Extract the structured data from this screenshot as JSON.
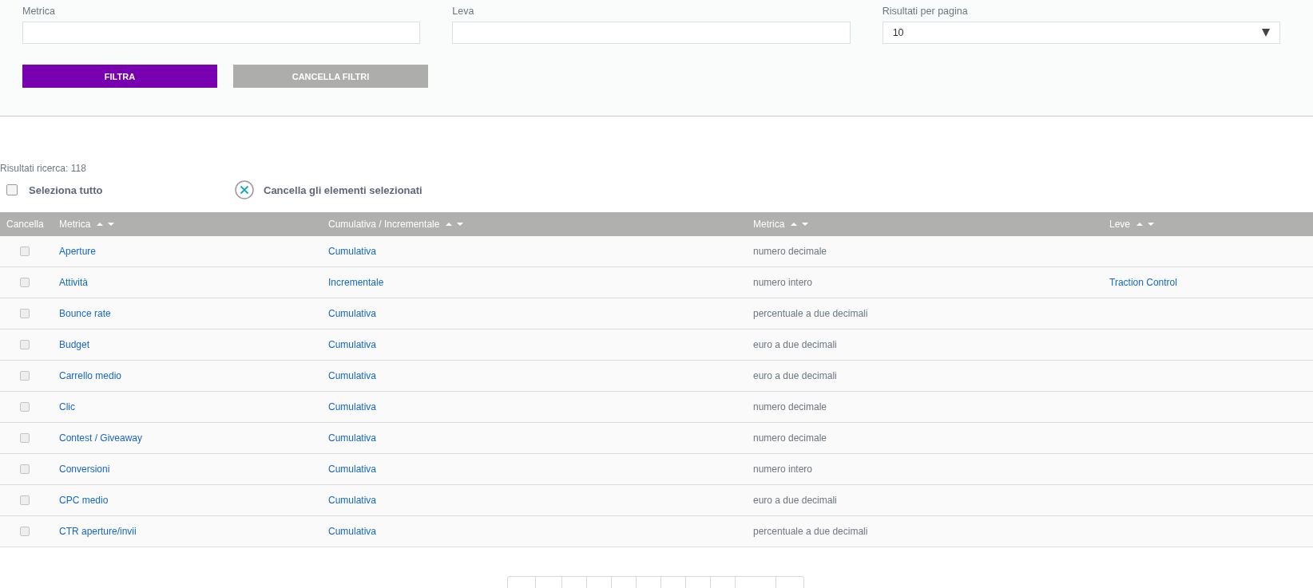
{
  "filters": {
    "fields": [
      {
        "label": "Metrica",
        "kind": "text"
      },
      {
        "label": "Leva",
        "kind": "text"
      },
      {
        "label": "Risultati per pagina",
        "kind": "select",
        "value": "10"
      }
    ],
    "buttons": [
      {
        "label": "FILTRA",
        "disabled": false
      },
      {
        "label": "CANCELLA FILTRI",
        "disabled": true
      }
    ]
  },
  "results": {
    "count": "Risultati ricerca: 118",
    "select_all": {
      "label": "Seleziona tutto",
      "checked": false
    },
    "delete_selected": "Cancella gli elementi selezionati"
  },
  "table": {
    "columns": [
      {
        "label": "Cancella",
        "sortable": false
      },
      {
        "label": "Metrica",
        "sortable": true
      },
      {
        "label": "Cumulativa / Incrementale",
        "sortable": true
      },
      {
        "label": "Metrica",
        "sortable": true
      },
      {
        "label": "Leve",
        "sortable": true
      }
    ],
    "rows": [
      {
        "checked": false,
        "metric": "Aperture",
        "type": "Cumulativa",
        "format": "numero decimale"
      },
      {
        "checked": false,
        "metric": "Attività",
        "type": "Incrementale",
        "format": "numero intero",
        "lever": "Traction Control"
      },
      {
        "checked": false,
        "metric": "Bounce rate",
        "type": "Cumulativa",
        "format": "percentuale a due decimali"
      },
      {
        "checked": false,
        "metric": "Budget",
        "type": "Cumulativa",
        "format": "euro a due decimali"
      },
      {
        "checked": false,
        "metric": "Carrello medio",
        "type": "Cumulativa",
        "format": "euro a due decimali"
      },
      {
        "checked": false,
        "metric": "Clic",
        "type": "Cumulativa",
        "format": "numero decimale"
      },
      {
        "checked": false,
        "metric": "Contest / Giveaway",
        "type": "Cumulativa",
        "format": "numero decimale"
      },
      {
        "checked": false,
        "metric": "Conversioni",
        "type": "Cumulativa",
        "format": "numero intero"
      },
      {
        "checked": false,
        "metric": "CPC medio",
        "type": "Cumulativa",
        "format": "euro a due decimali"
      },
      {
        "checked": false,
        "metric": "CTR aperture/invii",
        "type": "Cumulativa",
        "format": "percentuale a due decimali"
      }
    ]
  }
}
